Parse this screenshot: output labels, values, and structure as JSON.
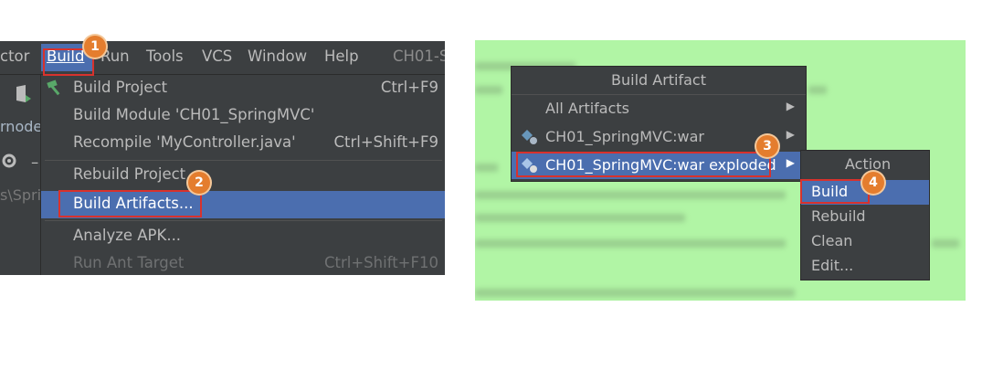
{
  "left": {
    "menubar": {
      "partial_left": "ctor",
      "items": [
        {
          "label": "Build",
          "active": true
        },
        {
          "label": "Run"
        },
        {
          "label": "Tools"
        },
        {
          "label": "VCS"
        },
        {
          "label": "Window"
        },
        {
          "label": "Help"
        }
      ],
      "title_partial": "CH01-S"
    },
    "gutter": {
      "node_text": "rnode",
      "path_text": "s\\Spri"
    },
    "dropdown": {
      "items": [
        {
          "label": "Build Project",
          "shortcut": "Ctrl+F9"
        },
        {
          "label": "Build Module 'CH01_SpringMVC'",
          "shortcut": ""
        },
        {
          "label": "Recompile 'MyController.java'",
          "shortcut": "Ctrl+Shift+F9"
        },
        {
          "label": "Rebuild Project",
          "shortcut": ""
        },
        {
          "label": "Build Artifacts...",
          "shortcut": ""
        },
        {
          "label": "Analyze APK...",
          "shortcut": ""
        },
        {
          "label": "Run Ant Target",
          "shortcut": "Ctrl+Shift+F10"
        }
      ]
    }
  },
  "right": {
    "artifact_popup": {
      "title": "Build Artifact",
      "items": [
        {
          "label": "All Artifacts"
        },
        {
          "label": "CH01_SpringMVC:war"
        },
        {
          "label": "CH01_SpringMVC:war exploded"
        }
      ]
    },
    "action_popup": {
      "title": "Action",
      "items": [
        {
          "label": "Build"
        },
        {
          "label": "Rebuild"
        },
        {
          "label": "Clean"
        },
        {
          "label": "Edit..."
        }
      ]
    }
  },
  "badges": {
    "b1": "1",
    "b2": "2",
    "b3": "3",
    "b4": "4"
  },
  "colors": {
    "ide_bg": "#3c3f41",
    "selection": "#4b6eaf",
    "callout_red": "#d8322d",
    "badge_orange": "#e47d2e",
    "panel_green": "#b1f5a5"
  }
}
